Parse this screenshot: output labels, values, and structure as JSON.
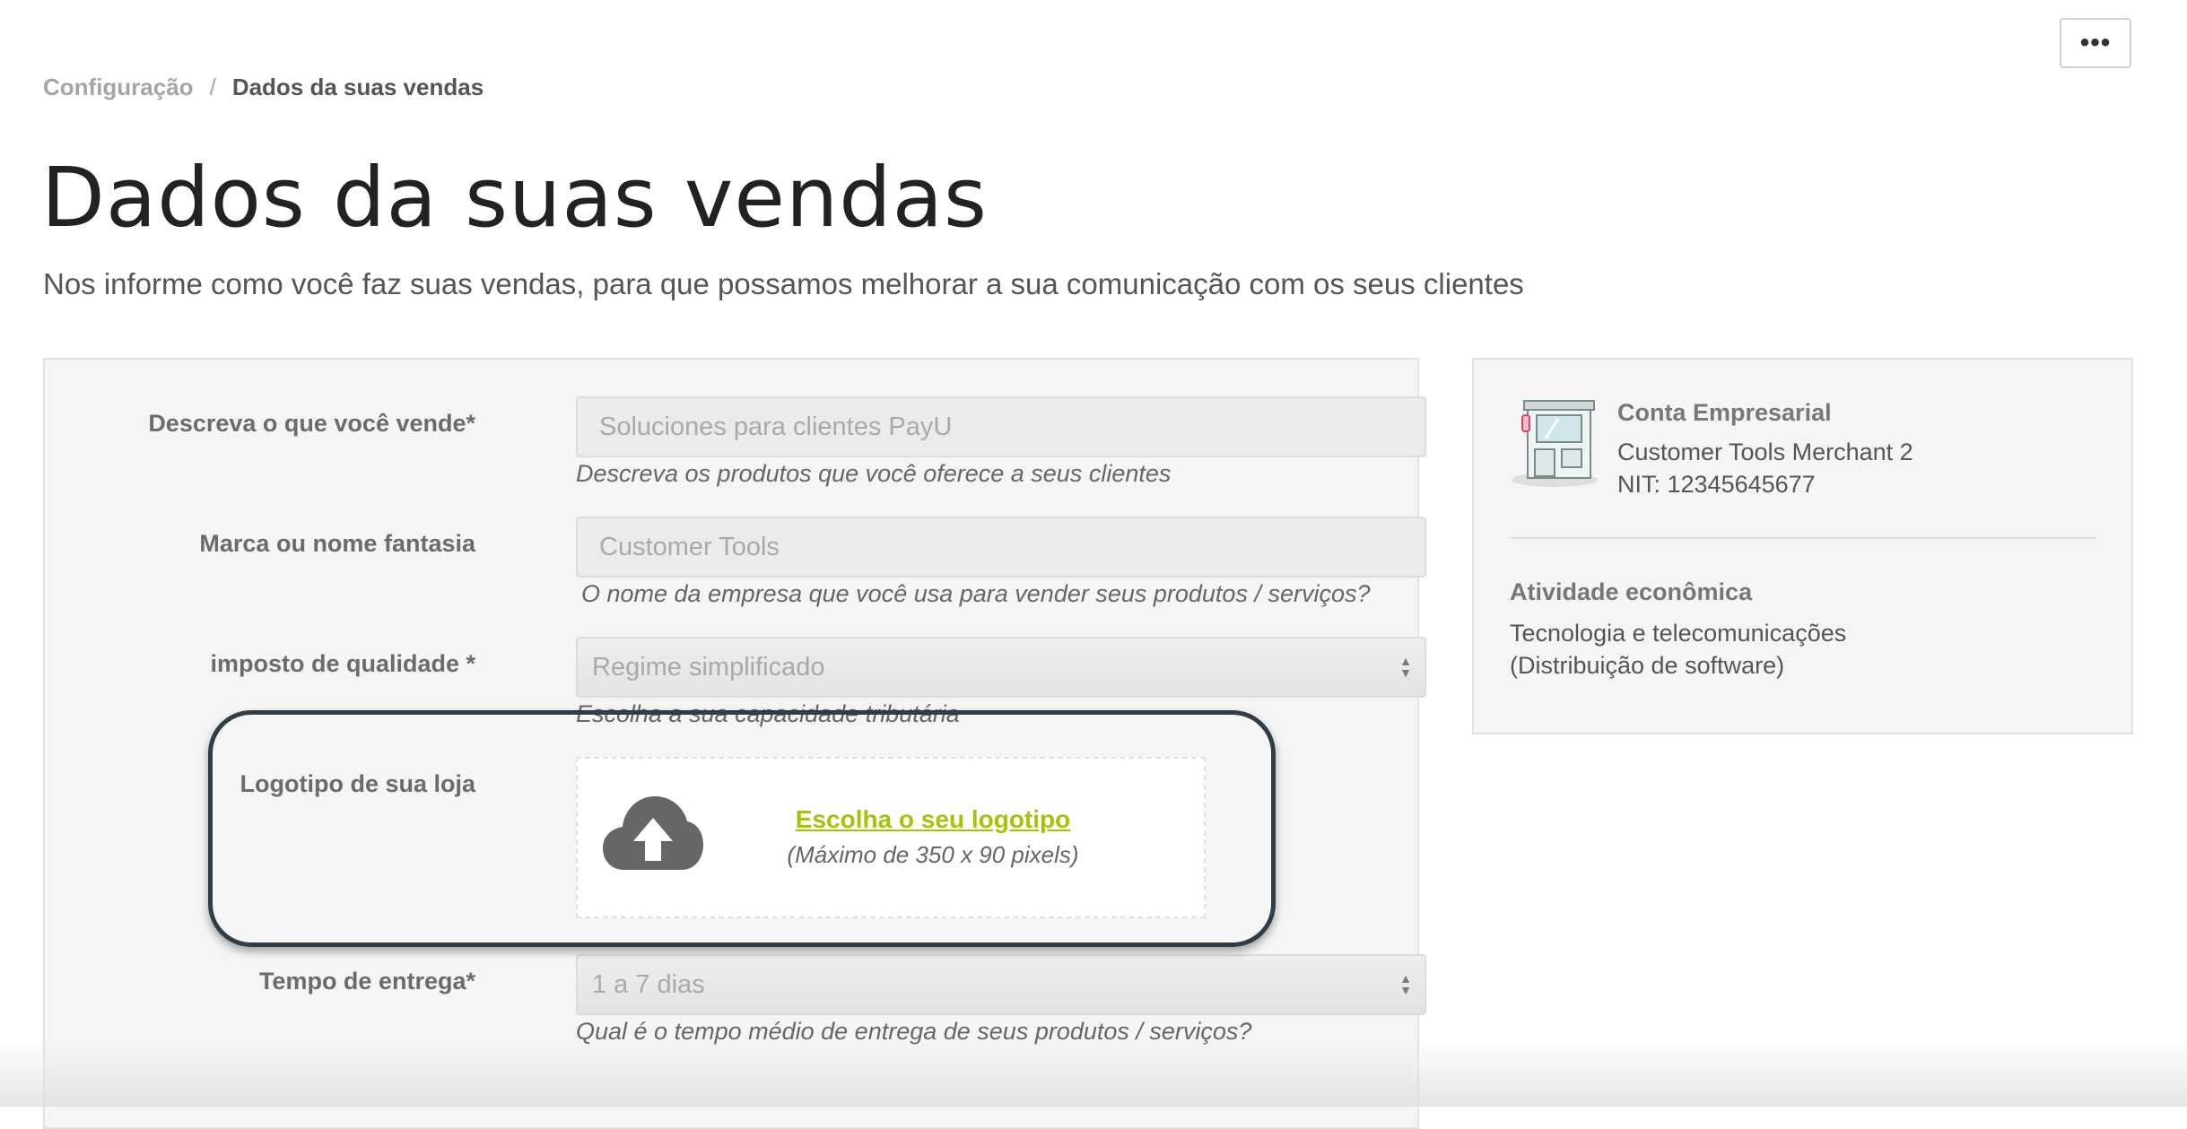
{
  "header": {
    "more_label": "•••",
    "breadcrumb": {
      "parent": "Configuração",
      "separator": "/",
      "current": "Dados da suas vendas"
    },
    "title": "Dados da suas vendas",
    "subtitle": "Nos informe como você faz suas vendas, para que possamos melhorar a sua comunicação com os seus clientes"
  },
  "form": {
    "description": {
      "label": "Descreva o que você vende*",
      "value": "Soluciones para clientes PayU",
      "hint": "Descreva os produtos que você oferece a seus clientes"
    },
    "brand": {
      "label": "Marca ou nome fantasia",
      "value": "Customer Tools",
      "hint": "O nome da empresa que você usa para vender seus produtos / serviços?"
    },
    "tax": {
      "label": "imposto de qualidade *",
      "selected": "Regime simplificado",
      "hint": "Escolha a sua capacidade tributária"
    },
    "logo": {
      "label": "Logotipo de sua loja",
      "icon": "cloud-upload-icon",
      "link": "Escolha o seu logotipo",
      "hint": "(Máximo de 350 x 90 pixels)"
    },
    "delivery": {
      "label": "Tempo de entrega*",
      "selected": "1 a 7 dias",
      "hint": "Qual é o tempo médio de entrega de seus produtos / serviços?"
    }
  },
  "account": {
    "icon": "storefront-icon",
    "type": "Conta Empresarial",
    "merchant": "Customer Tools Merchant 2",
    "nit": "NIT: 12345645677",
    "activity_title": "Atividade econômica",
    "activity_line1": "Tecnologia e telecomunicações",
    "activity_line2": "(Distribuição de software)"
  },
  "colors": {
    "accent_link": "#a6c307",
    "highlight_ring": "#2e3d48"
  }
}
